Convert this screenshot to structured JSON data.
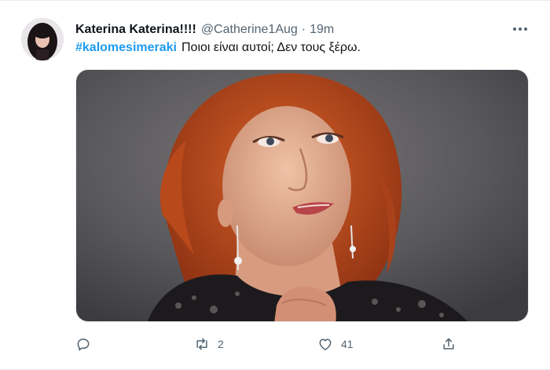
{
  "tweet": {
    "display_name": "Katerina Katerina!!!!",
    "handle": "@Catherine1Aug",
    "separator": "·",
    "time": "19m",
    "hashtag": "#kalomesimeraki",
    "text": "Ποιοι είναι αυτοί; Δεν τους ξέρω."
  },
  "actions": {
    "reply": {
      "icon": "reply-icon",
      "count": ""
    },
    "retweet": {
      "icon": "retweet-icon",
      "count": "2"
    },
    "like": {
      "icon": "heart-icon",
      "count": "41"
    },
    "share": {
      "icon": "share-icon",
      "count": ""
    }
  },
  "colors": {
    "link": "#1d9bf0",
    "secondary_text": "#536471",
    "primary_text": "#0f1419",
    "hair": "#c8501e"
  }
}
